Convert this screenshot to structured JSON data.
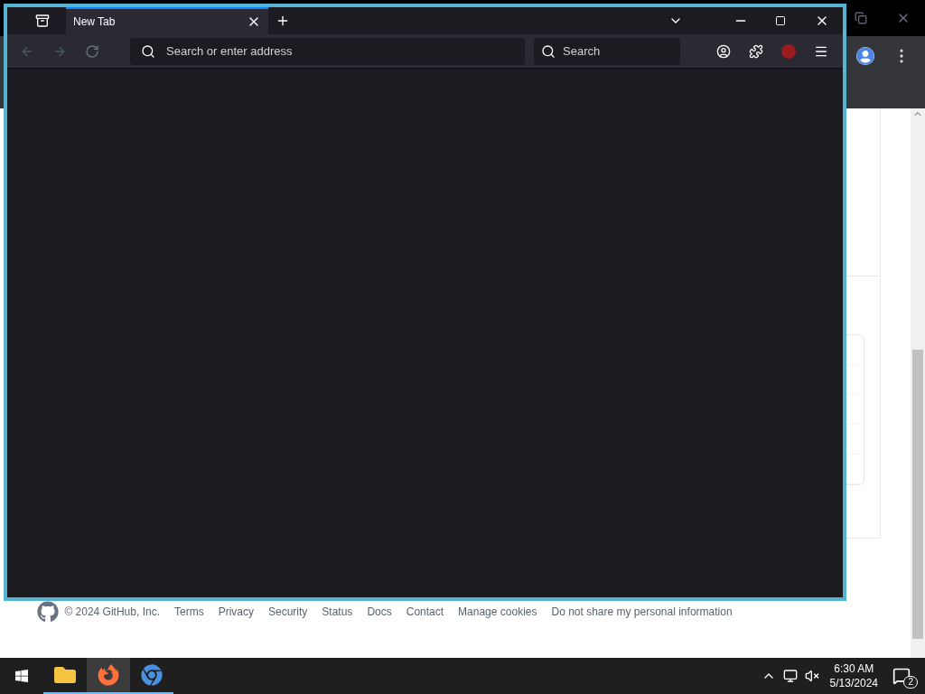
{
  "firefox": {
    "tabs": [
      {
        "label": "New Tab",
        "selected": true
      }
    ],
    "address_placeholder": "Search or enter address",
    "search_placeholder": "Search"
  },
  "github_footer": {
    "copyright": "© 2024 GitHub, Inc.",
    "links": [
      "Terms",
      "Privacy",
      "Security",
      "Status",
      "Docs",
      "Contact",
      "Manage cookies",
      "Do not share my personal information"
    ]
  },
  "taskbar": {
    "apps": [
      {
        "kind": "explorer",
        "selected": false
      },
      {
        "kind": "firefox",
        "selected": true
      },
      {
        "kind": "chrome",
        "selected": false
      }
    ],
    "time": "6:30 AM",
    "date": "5/13/2024",
    "notification_count": "2"
  }
}
